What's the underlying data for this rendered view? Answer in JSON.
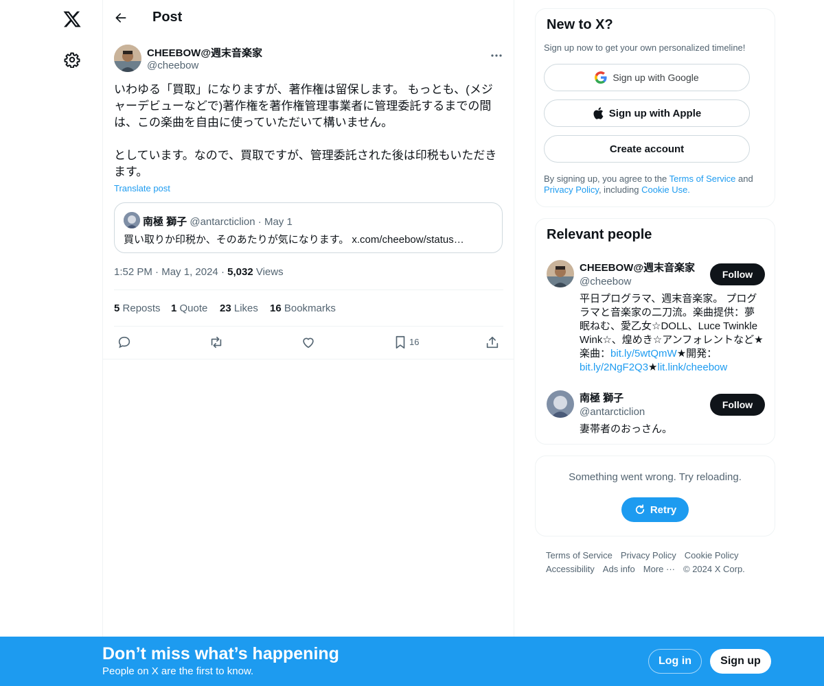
{
  "header": {
    "title": "Post"
  },
  "post": {
    "author_name": "CHEEBOW@週末音楽家",
    "author_handle": "@cheebow",
    "text": "いわゆる「買取」になりますが、著作権は留保します。 もっとも、(メジャーデビューなどで)著作権を著作権管理事業者に管理委託するまでの間は、この楽曲を自由に使っていただいて構いません。\n\nとしています。なので、買取ですが、管理委託された後は印税もいただきます。",
    "translate_label": "Translate post",
    "time": "1:52 PM",
    "date": "May 1, 2024",
    "views_count": "5,032",
    "views_label": "Views",
    "stats": [
      {
        "count": "5",
        "label": "Reposts"
      },
      {
        "count": "1",
        "label": "Quote"
      },
      {
        "count": "23",
        "label": "Likes"
      },
      {
        "count": "16",
        "label": "Bookmarks"
      }
    ],
    "bookmark_count": "16"
  },
  "quote": {
    "name": "南極 獅子",
    "handle": "@antarcticlion",
    "date": "May 1",
    "text": "買い取りか印税か、そのあたりが気になります。 x.com/cheebow/status…"
  },
  "signup_card": {
    "title": "New to X?",
    "subtitle": "Sign up now to get your own personalized timeline!",
    "google_label": "Sign up with Google",
    "apple_label": "Sign up with Apple",
    "create_label": "Create account",
    "legal_prefix": "By signing up, you agree to the ",
    "terms_label": "Terms of Service",
    "legal_and": " and ",
    "privacy_label": "Privacy Policy",
    "legal_including": ", including ",
    "cookie_label": "Cookie Use."
  },
  "relevant": {
    "title": "Relevant people",
    "people": [
      {
        "name": "CHEEBOW@週末音楽家",
        "handle": "@cheebow",
        "follow_label": "Follow",
        "bio_text": "平日プログラマ、週末音楽家。 プログラマと音楽家の二刀流。楽曲提供：夢眠ねむ、愛乙女☆DOLL、Luce Twinkle Wink☆、煌めき☆アンフォレントなど★楽曲：",
        "bio_link1": "bit.ly/5wtQmW",
        "bio_mid": "★開発：",
        "bio_link2": "bit.ly/2NgF2Q3",
        "bio_star": "★",
        "bio_link3": "lit.link/cheebow"
      },
      {
        "name": "南極 獅子",
        "handle": "@antarcticlion",
        "follow_label": "Follow",
        "bio_text": "妻帯者のおっさん。"
      }
    ]
  },
  "error_card": {
    "message": "Something went wrong. Try reloading.",
    "retry_label": "Retry"
  },
  "footer": {
    "links": [
      "Terms of Service",
      "Privacy Policy",
      "Cookie Policy",
      "Accessibility",
      "Ads info",
      "More ···"
    ],
    "copyright": "© 2024 X Corp."
  },
  "banner": {
    "title": "Don’t miss what’s happening",
    "subtitle": "People on X are the first to know.",
    "login_label": "Log in",
    "signup_label": "Sign up"
  },
  "colors": {
    "accent": "#1d9bf0",
    "text_primary": "#0f1419",
    "text_secondary": "#536471",
    "border": "#eff3f4"
  }
}
